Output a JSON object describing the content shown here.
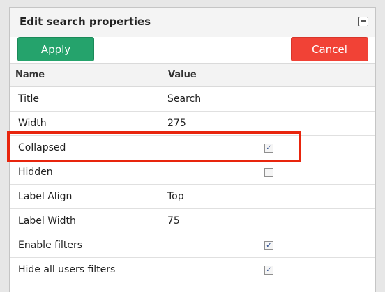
{
  "dialog": {
    "title": "Edit search properties",
    "collapse_icon": "window-collapse-icon"
  },
  "buttons": {
    "apply": "Apply",
    "cancel": "Cancel"
  },
  "grid": {
    "headers": {
      "name": "Name",
      "value": "Value"
    },
    "rows": [
      {
        "name": "Title",
        "value": "Search",
        "type": "text"
      },
      {
        "name": "Width",
        "value": "275",
        "type": "text"
      },
      {
        "name": "Collapsed",
        "checked": true,
        "type": "checkbox"
      },
      {
        "name": "Hidden",
        "checked": false,
        "type": "checkbox"
      },
      {
        "name": "Label Align",
        "value": "Top",
        "type": "text"
      },
      {
        "name": "Label Width",
        "value": "75",
        "type": "text"
      },
      {
        "name": "Enable filters",
        "checked": true,
        "type": "checkbox"
      },
      {
        "name": "Hide all users filters",
        "checked": true,
        "type": "checkbox"
      }
    ]
  },
  "colors": {
    "apply": "#25a36c",
    "cancel": "#f14236",
    "highlight": "#e8250d"
  }
}
